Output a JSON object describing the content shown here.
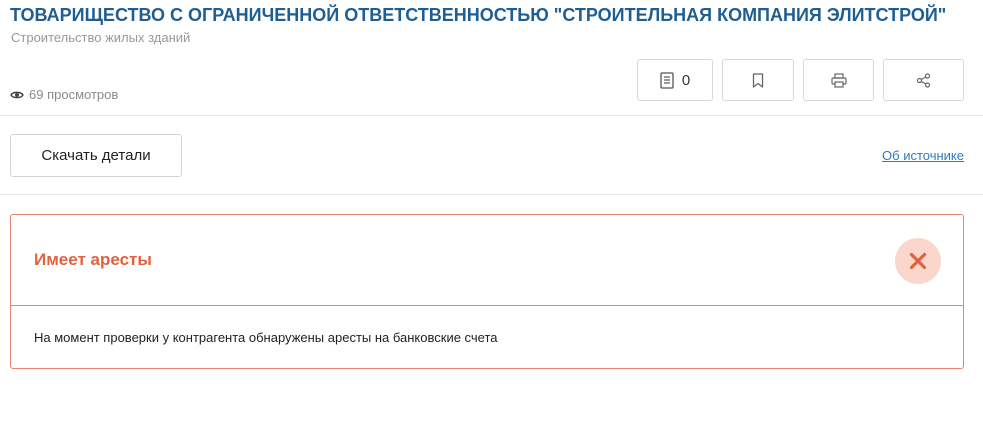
{
  "company": {
    "title": "ТОВАРИЩЕСТВО С ОГРАНИЧЕННОЙ ОТВЕТСТВЕННОСТЬЮ \"СТРОИТЕЛЬНАЯ КОМПАНИЯ ЭЛИТСТРОЙ\"",
    "activity": "Строительство жилых зданий",
    "views": "69 просмотров"
  },
  "toolbar": {
    "notes_count": "0",
    "icons": [
      "notes-icon",
      "bookmark-icon",
      "print-icon",
      "share-icon"
    ]
  },
  "actions": {
    "download_label": "Скачать детали",
    "source_link": "Об источнике"
  },
  "alert": {
    "title": "Имеет аресты",
    "text": "На момент проверки у контрагента обнаружены аресты на банковские счета",
    "status_icon": "close-icon",
    "accent_color": "#e0623e",
    "border_color": "#e9836b"
  },
  "colors": {
    "title": "#1f5e93",
    "link": "#2f7bbf"
  }
}
